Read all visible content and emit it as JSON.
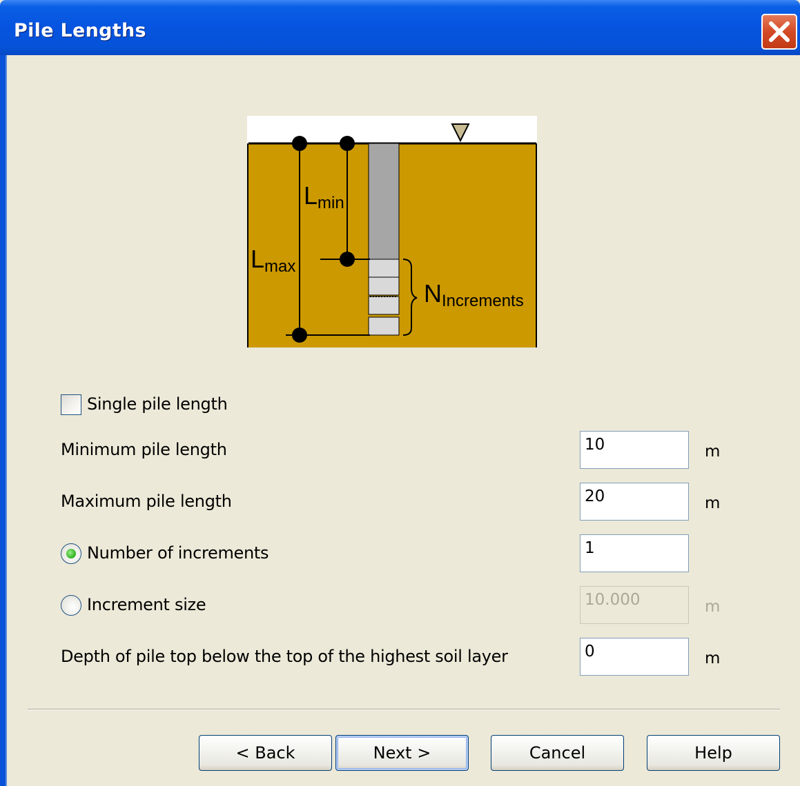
{
  "window": {
    "title": "Pile Lengths"
  },
  "diagram": {
    "lmax_main": "L",
    "lmax_sub": "max",
    "lmin_main": "L",
    "lmin_sub": "min",
    "ninc_main": "N",
    "ninc_sub": "Increments",
    "colors": {
      "soil": "#cc9900",
      "pile": "#a6a6a6",
      "increments": "#d9d9d9",
      "sky": "#ffffff",
      "water_marker": "#c8bc94"
    }
  },
  "form": {
    "single_pile_length": {
      "label": "Single pile length",
      "checked": false
    },
    "min_length": {
      "label": "Minimum pile length",
      "value": "10",
      "unit": "m"
    },
    "max_length": {
      "label": "Maximum pile length",
      "value": "20",
      "unit": "m"
    },
    "num_increments": {
      "label": "Number of increments",
      "value": "1",
      "selected": true
    },
    "increment_size": {
      "label": "Increment size",
      "value": "10.000",
      "unit": "m",
      "selected": false,
      "enabled": false
    },
    "depth_top": {
      "label": "Depth of pile top below the top of the highest soil layer",
      "value": "0",
      "unit": "m"
    }
  },
  "buttons": {
    "back": "< Back",
    "next": "Next >",
    "cancel": "Cancel",
    "help": "Help"
  }
}
